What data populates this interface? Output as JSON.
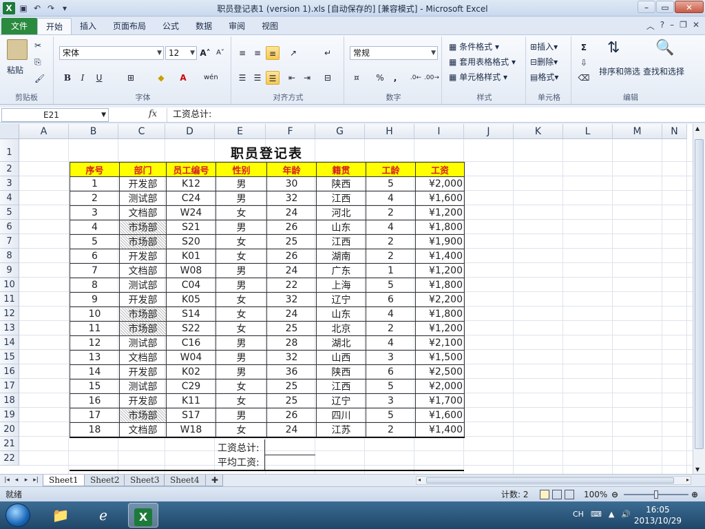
{
  "window": {
    "title": "职员登记表1 (version 1).xls [自动保存的]  [兼容模式] - Microsoft Excel",
    "app_icon": "X"
  },
  "ribbon": {
    "tabs": [
      "文件",
      "开始",
      "插入",
      "页面布局",
      "公式",
      "数据",
      "审阅",
      "视图"
    ],
    "active_tab": "开始",
    "clipboard": {
      "paste": "粘贴",
      "label": "剪贴板"
    },
    "font": {
      "name": "宋体",
      "size": "12",
      "label": "字体",
      "bold": "B",
      "italic": "I",
      "underline": "U"
    },
    "alignment": {
      "label": "对齐方式"
    },
    "number": {
      "format": "常规",
      "label": "数字",
      "percent": "%",
      "comma": ","
    },
    "styles": {
      "conditional": "条件格式",
      "table": "套用表格格式",
      "cell": "单元格样式",
      "label": "样式"
    },
    "cells": {
      "insert": "插入",
      "delete": "删除",
      "format": "格式",
      "label": "单元格"
    },
    "editing": {
      "sum": "Σ",
      "sort": "排序和筛选",
      "find": "查找和选择",
      "label": "编辑"
    }
  },
  "formula_bar": {
    "name_box": "E21",
    "fx": "fx",
    "content": "工资总计:"
  },
  "columns": [
    "A",
    "B",
    "C",
    "D",
    "E",
    "F",
    "G",
    "H",
    "I",
    "J",
    "K",
    "L",
    "M",
    "N"
  ],
  "rows": [
    "1",
    "2",
    "3",
    "4",
    "5",
    "6",
    "7",
    "8",
    "9",
    "10",
    "11",
    "12",
    "13",
    "14",
    "15",
    "16",
    "17",
    "18",
    "19",
    "20",
    "21",
    "22"
  ],
  "sheet": {
    "title": "职员登记表",
    "headers": [
      "序号",
      "部门",
      "员工编号",
      "性别",
      "年龄",
      "籍贯",
      "工龄",
      "工资"
    ],
    "records": [
      [
        "1",
        "开发部",
        "K12",
        "男",
        "30",
        "陕西",
        "5",
        "¥2,000"
      ],
      [
        "2",
        "测试部",
        "C24",
        "男",
        "32",
        "江西",
        "4",
        "¥1,600"
      ],
      [
        "3",
        "文档部",
        "W24",
        "女",
        "24",
        "河北",
        "2",
        "¥1,200"
      ],
      [
        "4",
        "市场部",
        "S21",
        "男",
        "26",
        "山东",
        "4",
        "¥1,800"
      ],
      [
        "5",
        "市场部",
        "S20",
        "女",
        "25",
        "江西",
        "2",
        "¥1,900"
      ],
      [
        "6",
        "开发部",
        "K01",
        "女",
        "26",
        "湖南",
        "2",
        "¥1,400"
      ],
      [
        "7",
        "文档部",
        "W08",
        "男",
        "24",
        "广东",
        "1",
        "¥1,200"
      ],
      [
        "8",
        "测试部",
        "C04",
        "男",
        "22",
        "上海",
        "5",
        "¥1,800"
      ],
      [
        "9",
        "开发部",
        "K05",
        "女",
        "32",
        "辽宁",
        "6",
        "¥2,200"
      ],
      [
        "10",
        "市场部",
        "S14",
        "女",
        "24",
        "山东",
        "4",
        "¥1,800"
      ],
      [
        "11",
        "市场部",
        "S22",
        "女",
        "25",
        "北京",
        "2",
        "¥1,200"
      ],
      [
        "12",
        "测试部",
        "C16",
        "男",
        "28",
        "湖北",
        "4",
        "¥2,100"
      ],
      [
        "13",
        "文档部",
        "W04",
        "男",
        "32",
        "山西",
        "3",
        "¥1,500"
      ],
      [
        "14",
        "开发部",
        "K02",
        "男",
        "36",
        "陕西",
        "6",
        "¥2,500"
      ],
      [
        "15",
        "测试部",
        "C29",
        "女",
        "25",
        "江西",
        "5",
        "¥2,000"
      ],
      [
        "16",
        "开发部",
        "K11",
        "女",
        "25",
        "辽宁",
        "3",
        "¥1,700"
      ],
      [
        "17",
        "市场部",
        "S17",
        "男",
        "26",
        "四川",
        "5",
        "¥1,600"
      ],
      [
        "18",
        "文档部",
        "W18",
        "女",
        "24",
        "江苏",
        "2",
        "¥1,400"
      ]
    ],
    "summary_total": "工资总计:",
    "summary_avg": "平均工资:"
  },
  "sheet_tabs": [
    "Sheet1",
    "Sheet2",
    "Sheet3",
    "Sheet4"
  ],
  "active_sheet": "Sheet1",
  "status": {
    "ready": "就绪",
    "count": "计数: 2",
    "zoom": "100%"
  },
  "taskbar": {
    "lang": "CH",
    "time": "16:05",
    "date": "2013/10/29"
  }
}
